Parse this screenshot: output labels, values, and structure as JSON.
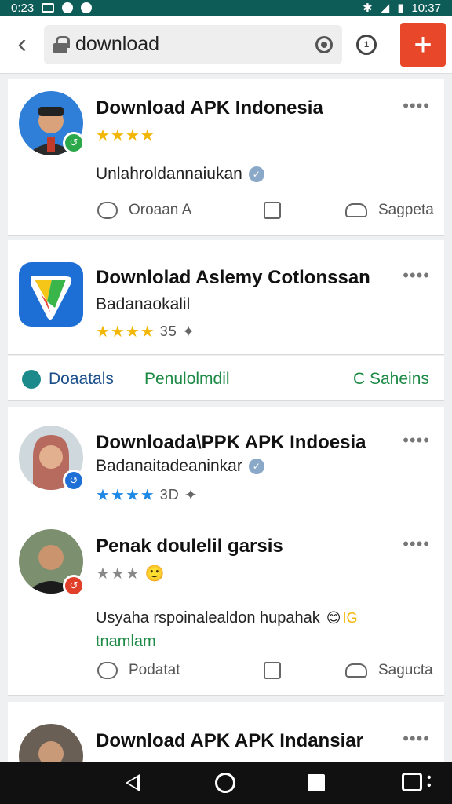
{
  "status_bar": {
    "time_left": "0:23",
    "time_right": "10:37"
  },
  "top_bar": {
    "search_value": "download"
  },
  "cards": [
    {
      "title": "Download APK Indonesia",
      "stars": "★★★★",
      "body": "Unlahroldannaiukan",
      "actions": {
        "comment": "Oroaan A",
        "like": "Sagpeta"
      }
    },
    {
      "title": "Downlolad Aslemy Cotlonssan",
      "subtitle": "Badanaokalil",
      "stars": "★★★★",
      "rating": "35"
    },
    {
      "title": "Downloada\\PPK APK Indoesia",
      "subtitle": "Badanaitadeaninkar",
      "stars": "★★★★",
      "rating": "3D"
    },
    {
      "title": "Penak doulelil garsis",
      "stars": "★★★",
      "body_line1": "Usyaha rspoinalealdon hupahak",
      "body_line1_suffix": "IG",
      "body_line2": "tnamlam",
      "actions": {
        "comment": "Podatat",
        "like": "Sagucta"
      }
    },
    {
      "title": "Download APK APK Indansiar"
    }
  ],
  "tab_row": {
    "tab1": "Doaatals",
    "tab2": "Penulolmdil",
    "tab3": "C Saheins"
  },
  "colors": {
    "status_bar": "#0e5c57",
    "accent_red": "#e8472a",
    "green": "#1c8a45",
    "blue_link": "#1a4f8a",
    "star_yellow": "#f2b705",
    "star_blue": "#1e88e5"
  }
}
